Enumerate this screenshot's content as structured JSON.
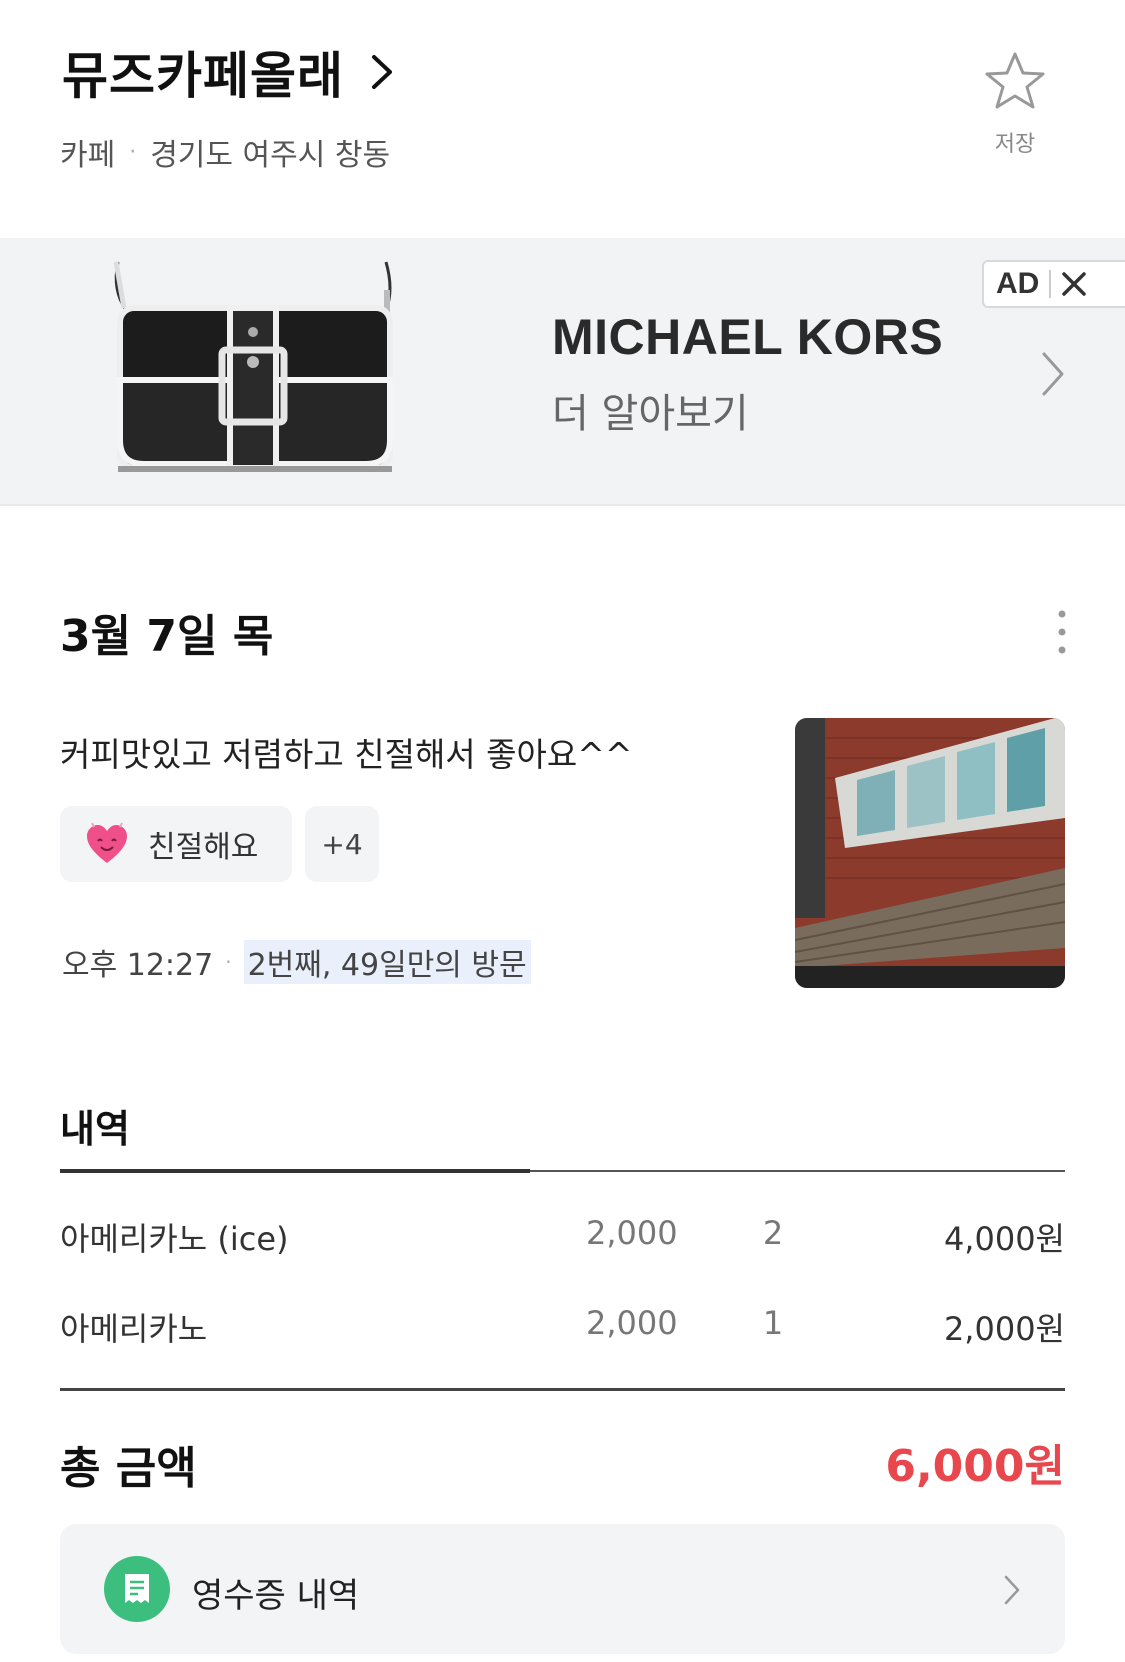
{
  "header": {
    "title": "뮤즈카페올래",
    "category": "카페",
    "separator": "·",
    "address": "경기도 여주시 창동",
    "save_label": "저장"
  },
  "ad": {
    "brand": "MICHAEL KORS",
    "cta": "더 알아보기",
    "badge": "AD"
  },
  "visit": {
    "date": "3월 7일 목",
    "review": "커피맛있고 저렴하고 친절해서 좋아요^^",
    "tag_label": "친절해요",
    "more_tags": "+4",
    "time": "오후 12:27",
    "separator": "·",
    "visit_count": "2번째, 49일만의 방문"
  },
  "receipt": {
    "title": "내역",
    "items": [
      {
        "name": "아메리카노 (ice)",
        "price": "2,000",
        "qty": "2",
        "total": "4,000원"
      },
      {
        "name": "아메리카노",
        "price": "2,000",
        "qty": "1",
        "total": "2,000원"
      }
    ],
    "total_label": "총 금액",
    "total_value": "6,000원",
    "history_label": "영수증 내역"
  },
  "colors": {
    "total_accent": "#e8474e",
    "receipt_icon_bg": "#3cbf7e",
    "chip_bg": "#f3f4f6",
    "ad_bg": "#f2f3f5"
  },
  "icons": {
    "title_chevron": "chevron-right-icon",
    "save": "star-outline-icon",
    "ad_close": "close-icon",
    "ad_chevron": "chevron-right-icon",
    "more": "more-vertical-icon",
    "tag": "smiling-heart-icon",
    "receipt": "receipt-icon",
    "receipt_chevron": "chevron-right-icon"
  }
}
